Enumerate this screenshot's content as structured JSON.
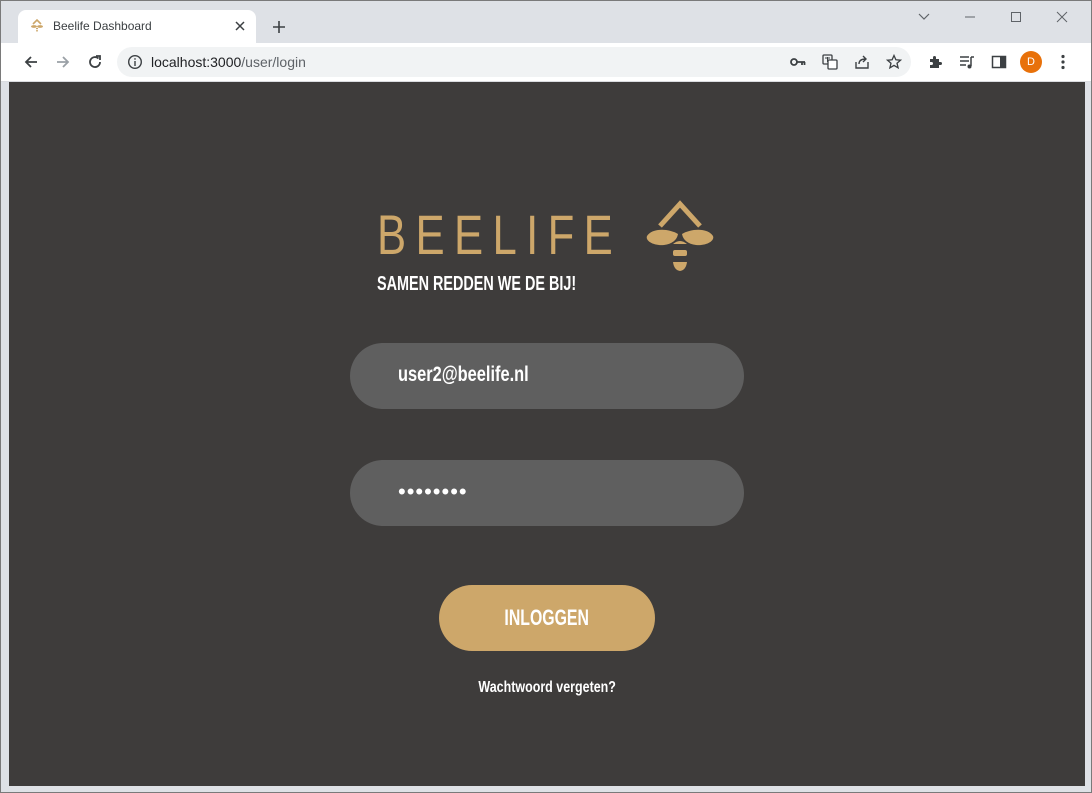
{
  "browser": {
    "tab_title": "Beelife Dashboard",
    "url_host": "localhost:3000",
    "url_path": "/user/login",
    "profile_initial": "D",
    "icons": [
      "beelife-favicon",
      "tab-close-icon",
      "new-tab-icon",
      "tab-search-icon",
      "minimize-icon",
      "maximize-icon",
      "window-close-icon",
      "back-icon",
      "forward-icon",
      "reload-icon",
      "site-info-icon",
      "password-key-icon",
      "translate-icon",
      "share-icon",
      "bookmark-star-icon",
      "extensions-icon",
      "media-control-icon",
      "side-panel-icon",
      "browser-menu-icon"
    ]
  },
  "login": {
    "brand": "BEELIFE",
    "tagline": "SAMEN REDDEN WE DE BIJ!",
    "email_value": "user2@beelife.nl",
    "password_mask": "••••••••",
    "login_button": "INLOGGEN",
    "forgot_link": "Wachtwoord vergeten?"
  },
  "colors": {
    "page_background": "#3e3c3b",
    "accent_gold": "#cda76a",
    "field_background": "#5f5f5f",
    "text": "#ffffff"
  }
}
